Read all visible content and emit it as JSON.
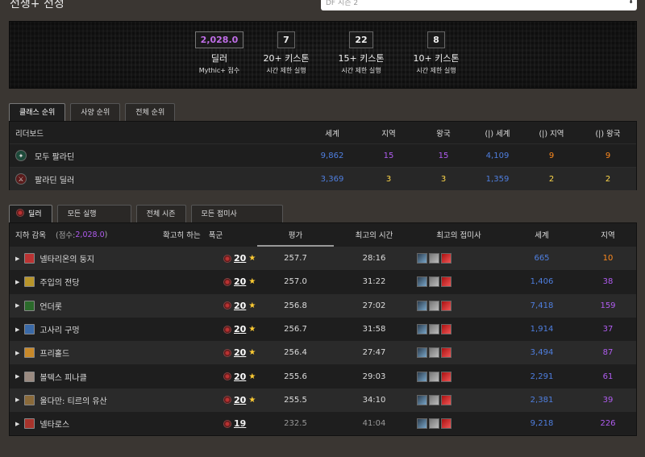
{
  "header": {
    "title": "전쟁+ 전정",
    "season_select": "DF 시즌 2"
  },
  "score": {
    "rating": "2,028.0",
    "rating_label": "딜러",
    "rating_sub": "Mythic+ 점수",
    "stats": [
      {
        "value": "7",
        "label": "20+ 키스톤",
        "sub": "시간 제한 실행"
      },
      {
        "value": "22",
        "label": "15+ 키스톤",
        "sub": "시간 제한 실행"
      },
      {
        "value": "8",
        "label": "10+ 키스톤",
        "sub": "시간 제한 실행"
      }
    ]
  },
  "leaderboard_tabs": [
    "클래스 순위",
    "사양 순위",
    "전체 순위"
  ],
  "leaderboard": {
    "headers": {
      "name": "리더보드",
      "world": "세계",
      "region": "지역",
      "realm": "왕국",
      "f_world": "(|) 세계",
      "f_region": "(|) 지역",
      "f_realm": "(|) 왕국"
    },
    "rows": [
      {
        "name": "모두 팔라딘",
        "world": "9,862",
        "region": "15",
        "realm": "15",
        "f_world": "4,109",
        "f_region": "9",
        "f_realm": "9"
      },
      {
        "name": "팔라딘 딜러",
        "world": "3,369",
        "region": "3",
        "realm": "3",
        "f_world": "1,359",
        "f_region": "2",
        "f_realm": "2"
      }
    ]
  },
  "run_tabs": [
    "딜러",
    "모든 실행",
    "전체 시즌",
    "모든 접미사"
  ],
  "runs": {
    "headers": {
      "dungeon": "지하 감옥",
      "score_prefix": "(점수: ",
      "score_value": "2,028.0",
      "score_suffix": ")",
      "key_prefix": "확고히 하는",
      "key": "폭군",
      "rating": "평가",
      "best_time": "최고의 시간",
      "best_affix": "최고의 접미사",
      "world": "세계",
      "region": "지역"
    },
    "rows": [
      {
        "dungeon": "넬타리온의 둥지",
        "level": "20",
        "rating": "257.7",
        "time": "28:16",
        "world": "665",
        "region": "10"
      },
      {
        "dungeon": "주입의 전당",
        "level": "20",
        "rating": "257.0",
        "time": "31:22",
        "world": "1,406",
        "region": "38"
      },
      {
        "dungeon": "언더롯",
        "level": "20",
        "rating": "256.8",
        "time": "27:02",
        "world": "7,418",
        "region": "159"
      },
      {
        "dungeon": "고사리 구멍",
        "level": "20",
        "rating": "256.7",
        "time": "31:58",
        "world": "1,914",
        "region": "37"
      },
      {
        "dungeon": "프리홀드",
        "level": "20",
        "rating": "256.4",
        "time": "27:47",
        "world": "3,494",
        "region": "87"
      },
      {
        "dungeon": "볼텍스 피나클",
        "level": "20",
        "rating": "255.6",
        "time": "29:03",
        "world": "2,291",
        "region": "61"
      },
      {
        "dungeon": "울다만: 티르의 유산",
        "level": "20",
        "rating": "255.5",
        "time": "34:10",
        "world": "2,381",
        "region": "39"
      },
      {
        "dungeon": "넬타로스",
        "level": "19",
        "rating": "232.5",
        "time": "41:04",
        "world": "9,218",
        "region": "226"
      }
    ]
  },
  "colors": {
    "accent_purple": "#b05cf0",
    "world_blue": "#4f7fe0",
    "region_orange": "#ff8a1e",
    "realm_yellow": "#ffd84a"
  }
}
